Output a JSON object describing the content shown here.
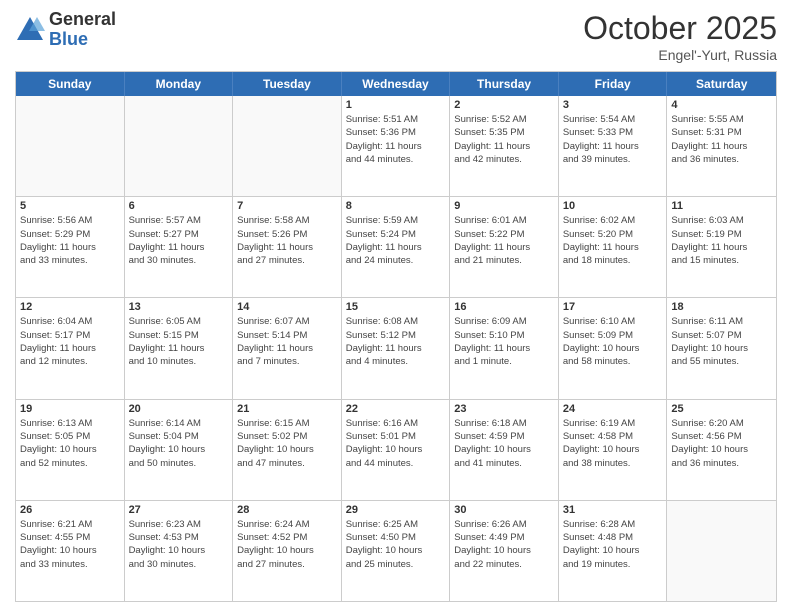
{
  "header": {
    "logo": {
      "general": "General",
      "blue": "Blue"
    },
    "month": "October 2025",
    "location": "Engel'-Yurt, Russia"
  },
  "day_headers": [
    "Sunday",
    "Monday",
    "Tuesday",
    "Wednesday",
    "Thursday",
    "Friday",
    "Saturday"
  ],
  "weeks": [
    [
      {
        "day": "",
        "empty": true,
        "info": ""
      },
      {
        "day": "",
        "empty": true,
        "info": ""
      },
      {
        "day": "",
        "empty": true,
        "info": ""
      },
      {
        "day": "1",
        "info": "Sunrise: 5:51 AM\nSunset: 5:36 PM\nDaylight: 11 hours\nand 44 minutes."
      },
      {
        "day": "2",
        "info": "Sunrise: 5:52 AM\nSunset: 5:35 PM\nDaylight: 11 hours\nand 42 minutes."
      },
      {
        "day": "3",
        "info": "Sunrise: 5:54 AM\nSunset: 5:33 PM\nDaylight: 11 hours\nand 39 minutes."
      },
      {
        "day": "4",
        "info": "Sunrise: 5:55 AM\nSunset: 5:31 PM\nDaylight: 11 hours\nand 36 minutes."
      }
    ],
    [
      {
        "day": "5",
        "info": "Sunrise: 5:56 AM\nSunset: 5:29 PM\nDaylight: 11 hours\nand 33 minutes."
      },
      {
        "day": "6",
        "info": "Sunrise: 5:57 AM\nSunset: 5:27 PM\nDaylight: 11 hours\nand 30 minutes."
      },
      {
        "day": "7",
        "info": "Sunrise: 5:58 AM\nSunset: 5:26 PM\nDaylight: 11 hours\nand 27 minutes."
      },
      {
        "day": "8",
        "info": "Sunrise: 5:59 AM\nSunset: 5:24 PM\nDaylight: 11 hours\nand 24 minutes."
      },
      {
        "day": "9",
        "info": "Sunrise: 6:01 AM\nSunset: 5:22 PM\nDaylight: 11 hours\nand 21 minutes."
      },
      {
        "day": "10",
        "info": "Sunrise: 6:02 AM\nSunset: 5:20 PM\nDaylight: 11 hours\nand 18 minutes."
      },
      {
        "day": "11",
        "info": "Sunrise: 6:03 AM\nSunset: 5:19 PM\nDaylight: 11 hours\nand 15 minutes."
      }
    ],
    [
      {
        "day": "12",
        "info": "Sunrise: 6:04 AM\nSunset: 5:17 PM\nDaylight: 11 hours\nand 12 minutes."
      },
      {
        "day": "13",
        "info": "Sunrise: 6:05 AM\nSunset: 5:15 PM\nDaylight: 11 hours\nand 10 minutes."
      },
      {
        "day": "14",
        "info": "Sunrise: 6:07 AM\nSunset: 5:14 PM\nDaylight: 11 hours\nand 7 minutes."
      },
      {
        "day": "15",
        "info": "Sunrise: 6:08 AM\nSunset: 5:12 PM\nDaylight: 11 hours\nand 4 minutes."
      },
      {
        "day": "16",
        "info": "Sunrise: 6:09 AM\nSunset: 5:10 PM\nDaylight: 11 hours\nand 1 minute."
      },
      {
        "day": "17",
        "info": "Sunrise: 6:10 AM\nSunset: 5:09 PM\nDaylight: 10 hours\nand 58 minutes."
      },
      {
        "day": "18",
        "info": "Sunrise: 6:11 AM\nSunset: 5:07 PM\nDaylight: 10 hours\nand 55 minutes."
      }
    ],
    [
      {
        "day": "19",
        "info": "Sunrise: 6:13 AM\nSunset: 5:05 PM\nDaylight: 10 hours\nand 52 minutes."
      },
      {
        "day": "20",
        "info": "Sunrise: 6:14 AM\nSunset: 5:04 PM\nDaylight: 10 hours\nand 50 minutes."
      },
      {
        "day": "21",
        "info": "Sunrise: 6:15 AM\nSunset: 5:02 PM\nDaylight: 10 hours\nand 47 minutes."
      },
      {
        "day": "22",
        "info": "Sunrise: 6:16 AM\nSunset: 5:01 PM\nDaylight: 10 hours\nand 44 minutes."
      },
      {
        "day": "23",
        "info": "Sunrise: 6:18 AM\nSunset: 4:59 PM\nDaylight: 10 hours\nand 41 minutes."
      },
      {
        "day": "24",
        "info": "Sunrise: 6:19 AM\nSunset: 4:58 PM\nDaylight: 10 hours\nand 38 minutes."
      },
      {
        "day": "25",
        "info": "Sunrise: 6:20 AM\nSunset: 4:56 PM\nDaylight: 10 hours\nand 36 minutes."
      }
    ],
    [
      {
        "day": "26",
        "info": "Sunrise: 6:21 AM\nSunset: 4:55 PM\nDaylight: 10 hours\nand 33 minutes."
      },
      {
        "day": "27",
        "info": "Sunrise: 6:23 AM\nSunset: 4:53 PM\nDaylight: 10 hours\nand 30 minutes."
      },
      {
        "day": "28",
        "info": "Sunrise: 6:24 AM\nSunset: 4:52 PM\nDaylight: 10 hours\nand 27 minutes."
      },
      {
        "day": "29",
        "info": "Sunrise: 6:25 AM\nSunset: 4:50 PM\nDaylight: 10 hours\nand 25 minutes."
      },
      {
        "day": "30",
        "info": "Sunrise: 6:26 AM\nSunset: 4:49 PM\nDaylight: 10 hours\nand 22 minutes."
      },
      {
        "day": "31",
        "info": "Sunrise: 6:28 AM\nSunset: 4:48 PM\nDaylight: 10 hours\nand 19 minutes."
      },
      {
        "day": "",
        "empty": true,
        "info": ""
      }
    ]
  ]
}
